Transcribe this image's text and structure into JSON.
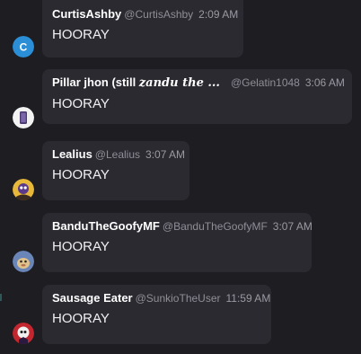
{
  "messages": [
    {
      "author": "CurtisAshby",
      "handle": "@CurtisAshby",
      "time": "2:09 AM",
      "text": "HOORAY",
      "avatar": {
        "icon": "letter-c-avatar-icon",
        "letter": "C",
        "color": "#2a8fd6"
      }
    },
    {
      "author": "Pillar jhon (still ",
      "author_fancy": "zandu the ...",
      "handle": "@Gelatin1048",
      "time": "3:06 AM",
      "text": "HOORAY",
      "avatar": {
        "icon": "phone-avatar-icon",
        "color": "#f2f2f2"
      }
    },
    {
      "author": "Lealius",
      "handle": "@Lealius",
      "time": "3:07 AM",
      "text": "HOORAY",
      "avatar": {
        "icon": "character-avatar-icon",
        "color": "#e7b83a"
      }
    },
    {
      "author": "BanduTheGoofyMF",
      "handle": "@BanduTheGoofyMF",
      "time": "3:07 AM",
      "text": "HOORAY",
      "avatar": {
        "icon": "creature-avatar-icon",
        "color": "#6a86b8"
      }
    },
    {
      "author": "Sausage Eater",
      "handle": "@SunkioTheUser",
      "time": "11:59 AM",
      "text": "HOORAY",
      "avatar": {
        "icon": "character-avatar-icon",
        "color": "#c2262e"
      }
    }
  ]
}
